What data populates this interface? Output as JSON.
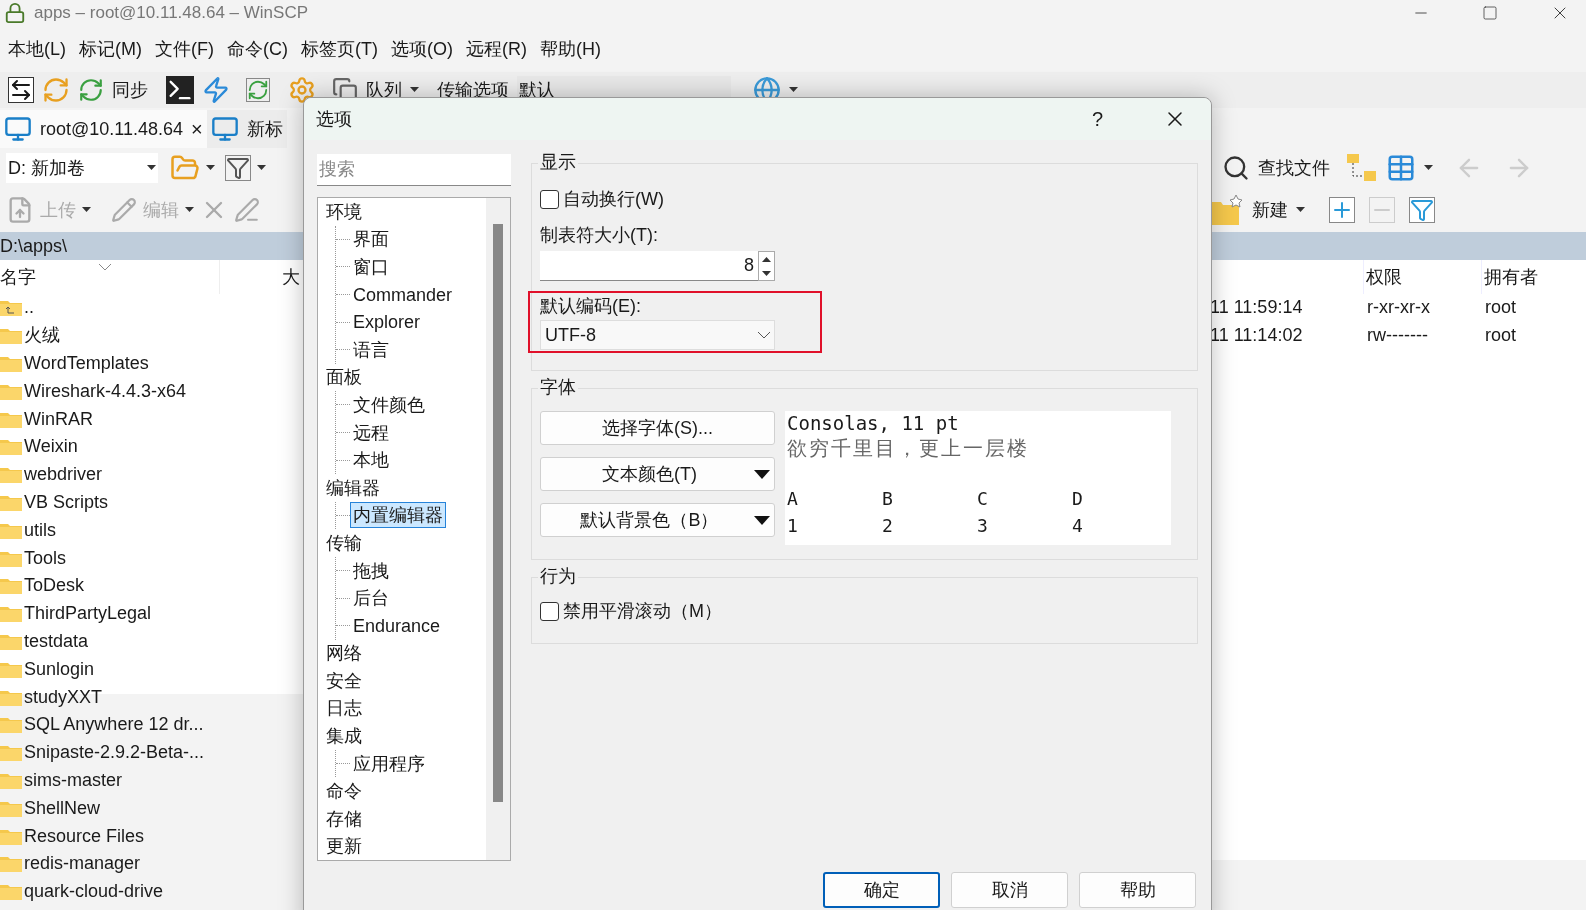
{
  "window": {
    "title": "apps – root@10.11.48.64 – WinSCP"
  },
  "menu": [
    "本地(L)",
    "标记(M)",
    "文件(F)",
    "命令(C)",
    "标签页(T)",
    "选项(O)",
    "远程(R)",
    "帮助(H)"
  ],
  "toolbar": {
    "sync": "同步",
    "queue": "队列",
    "transfer_label": "传输选项",
    "transfer_value": "默认"
  },
  "session_tabs": [
    {
      "label": "root@10.11.48.64",
      "close": "×",
      "selected": true
    },
    {
      "label": "新标",
      "selected": false
    }
  ],
  "local_panel": {
    "drive": "D: 新加卷",
    "upload": "上传",
    "edit": "编辑",
    "path": "D:\\apps\\",
    "columns": [
      "名字",
      "大"
    ],
    "rows": [
      {
        "name": "..",
        "kind": "parent"
      },
      {
        "name": "火绒",
        "kind": "folder"
      },
      {
        "name": "WordTemplates",
        "kind": "folder"
      },
      {
        "name": "Wireshark-4.4.3-x64",
        "kind": "folder"
      },
      {
        "name": "WinRAR",
        "kind": "folder"
      },
      {
        "name": "Weixin",
        "kind": "folder"
      },
      {
        "name": "webdriver",
        "kind": "folder"
      },
      {
        "name": "VB Scripts",
        "kind": "folder"
      },
      {
        "name": "utils",
        "kind": "folder"
      },
      {
        "name": "Tools",
        "kind": "folder"
      },
      {
        "name": "ToDesk",
        "kind": "folder"
      },
      {
        "name": "ThirdPartyLegal",
        "kind": "folder"
      },
      {
        "name": "testdata",
        "kind": "folder"
      },
      {
        "name": "Sunlogin",
        "kind": "folder"
      },
      {
        "name": "studyXXT",
        "kind": "folder"
      },
      {
        "name": "SQL Anywhere 12 dr...",
        "kind": "folder"
      },
      {
        "name": "Snipaste-2.9.2-Beta-...",
        "kind": "folder"
      },
      {
        "name": "sims-master",
        "kind": "folder"
      },
      {
        "name": "ShellNew",
        "kind": "folder"
      },
      {
        "name": "Resource Files",
        "kind": "folder"
      },
      {
        "name": "redis-manager",
        "kind": "folder"
      },
      {
        "name": "quark-cloud-drive",
        "kind": "folder"
      }
    ]
  },
  "remote_panel": {
    "find": "查找文件",
    "new": "新建",
    "columns": [
      "权限",
      "拥有者"
    ],
    "rows": [
      {
        "modified": "11 11:59:14",
        "rights": "r-xr-xr-x",
        "owner": "root"
      },
      {
        "modified": "11 11:14:02",
        "rights": "rw-------",
        "owner": "root"
      }
    ]
  },
  "dialog": {
    "title": "选项",
    "help": "?",
    "search_placeholder": "搜索",
    "tree": [
      {
        "label": "环境",
        "selected": false,
        "children": [
          {
            "label": "界面",
            "selected": false
          },
          {
            "label": "窗口",
            "selected": false
          },
          {
            "label": "Commander",
            "selected": false
          },
          {
            "label": "Explorer",
            "selected": false
          },
          {
            "label": "语言",
            "selected": false
          }
        ]
      },
      {
        "label": "面板",
        "selected": false,
        "children": [
          {
            "label": "文件颜色",
            "selected": false
          },
          {
            "label": "远程",
            "selected": false
          },
          {
            "label": "本地",
            "selected": false
          }
        ]
      },
      {
        "label": "编辑器",
        "selected": false,
        "children": [
          {
            "label": "内置编辑器",
            "selected": true
          }
        ]
      },
      {
        "label": "传输",
        "selected": false,
        "children": [
          {
            "label": "拖拽",
            "selected": false
          },
          {
            "label": "后台",
            "selected": false
          },
          {
            "label": "Endurance",
            "selected": false
          }
        ]
      },
      {
        "label": "网络",
        "selected": false
      },
      {
        "label": "安全",
        "selected": false
      },
      {
        "label": "日志",
        "selected": false
      },
      {
        "label": "集成",
        "selected": false,
        "children": [
          {
            "label": "应用程序",
            "selected": false
          }
        ]
      },
      {
        "label": "命令",
        "selected": false
      },
      {
        "label": "存储",
        "selected": false
      },
      {
        "label": "更新",
        "selected": false
      }
    ],
    "display": {
      "title": "显示",
      "wrap": {
        "label": "自动换行(W)",
        "checked": false
      },
      "tab_size": {
        "label": "制表符大小(T):",
        "value": "8"
      },
      "encoding": {
        "label": "默认编码(E):",
        "value": "UTF-8",
        "highlighted": true
      }
    },
    "font": {
      "title": "字体",
      "buttons": [
        {
          "label": "选择字体(S)...",
          "kind": "plain"
        },
        {
          "label": "文本颜色(T)",
          "kind": "dropdown"
        },
        {
          "label": "默认背景色（B）",
          "kind": "dropdown"
        }
      ],
      "preview": {
        "font": "Consolas, 11 pt",
        "sample": "欲穷千里目，更上一层楼",
        "headers": [
          "A",
          "B",
          "C",
          "D"
        ],
        "values": [
          "1",
          "2",
          "3",
          "4"
        ]
      }
    },
    "behavior": {
      "title": "行为",
      "smooth": {
        "label": "禁用平滑滚动（M）",
        "checked": false
      }
    },
    "buttons": [
      "确定",
      "取消",
      "帮助"
    ]
  }
}
